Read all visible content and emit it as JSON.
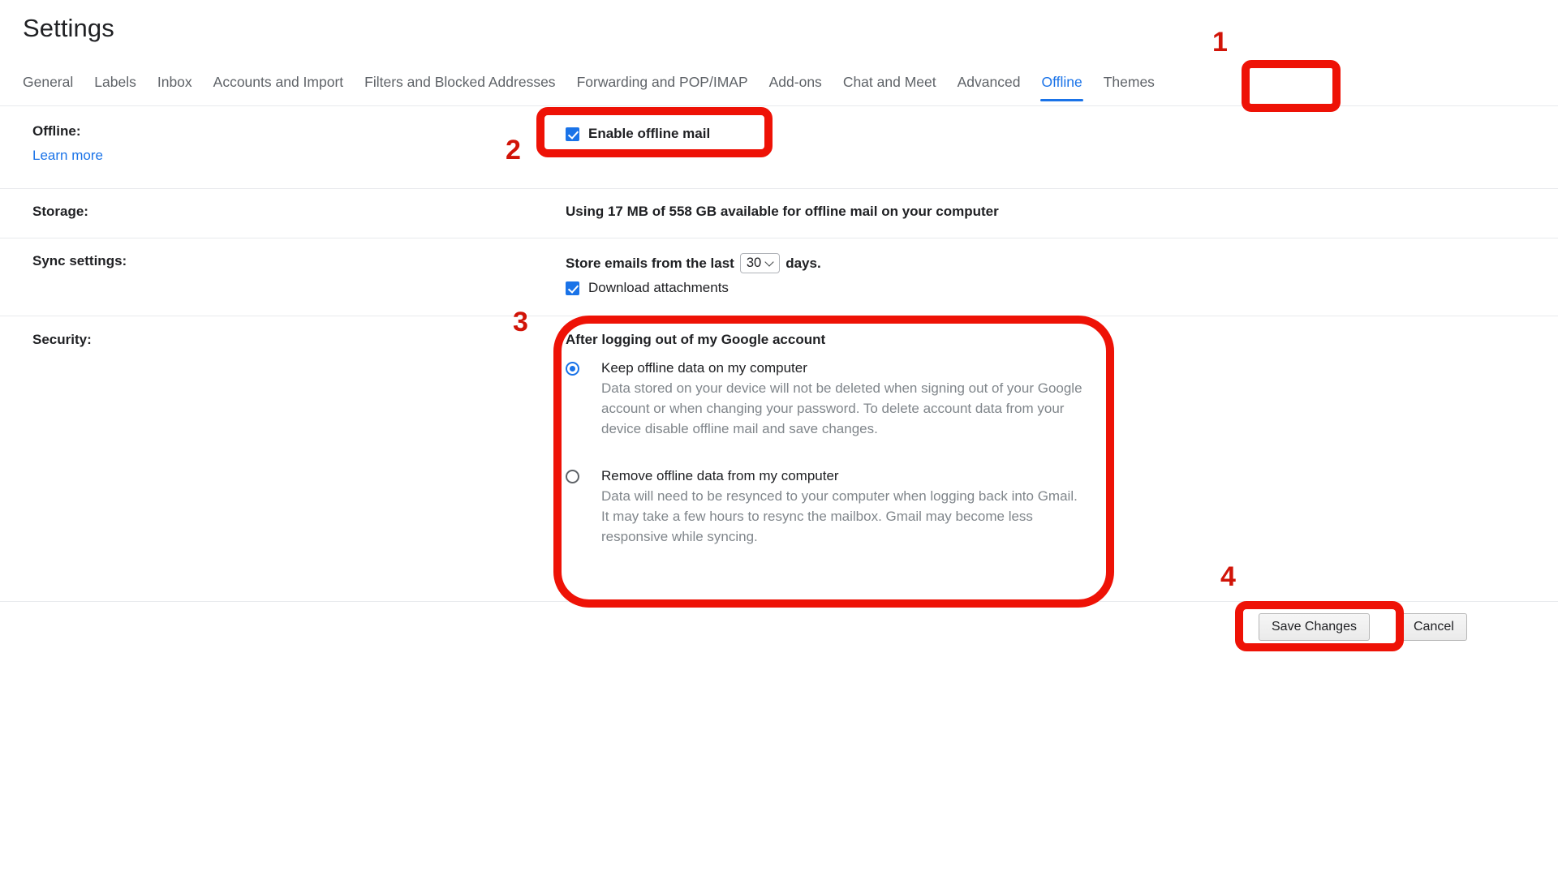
{
  "header": {
    "title": "Settings"
  },
  "tabs": [
    {
      "label": "General",
      "active": false
    },
    {
      "label": "Labels",
      "active": false
    },
    {
      "label": "Inbox",
      "active": false
    },
    {
      "label": "Accounts and Import",
      "active": false
    },
    {
      "label": "Filters and Blocked Addresses",
      "active": false
    },
    {
      "label": "Forwarding and POP/IMAP",
      "active": false
    },
    {
      "label": "Add-ons",
      "active": false
    },
    {
      "label": "Chat and Meet",
      "active": false
    },
    {
      "label": "Advanced",
      "active": false
    },
    {
      "label": "Offline",
      "active": true
    },
    {
      "label": "Themes",
      "active": false
    }
  ],
  "rows": {
    "offline": {
      "label": "Offline:",
      "learn_more": "Learn more",
      "enable_checkbox": {
        "label": "Enable offline mail",
        "checked": true
      }
    },
    "storage": {
      "label": "Storage:",
      "text": "Using 17 MB of 558 GB available for offline mail on your computer"
    },
    "sync": {
      "label": "Sync settings:",
      "prefix": "Store emails from the last",
      "days_value": "30",
      "suffix": "days.",
      "download_checkbox": {
        "label": "Download attachments",
        "checked": true
      }
    },
    "security": {
      "label": "Security:",
      "heading": "After logging out of my Google account",
      "options": [
        {
          "title": "Keep offline data on my computer",
          "description": "Data stored on your device will not be deleted when signing out of your Google account or when changing your password. To delete account data from your device disable offline mail and save changes.",
          "selected": true
        },
        {
          "title": "Remove offline data from my computer",
          "description": "Data will need to be resynced to your computer when logging back into Gmail. It may take a few hours to resync the mailbox. Gmail may become less responsive while syncing.",
          "selected": false
        }
      ]
    }
  },
  "buttons": {
    "save": "Save Changes",
    "cancel": "Cancel"
  },
  "annotations": [
    {
      "number": "1",
      "target": "offline-tab"
    },
    {
      "number": "2",
      "target": "enable-offline-mail-checkbox"
    },
    {
      "number": "3",
      "target": "security-options-group"
    },
    {
      "number": "4",
      "target": "save-changes-button"
    }
  ],
  "colors": {
    "accent_blue": "#1a73e8",
    "annotation_red": "#ee1206",
    "text_primary": "#202124",
    "text_secondary": "#5f6368",
    "text_muted": "#80868b",
    "divider": "#e8eaed"
  }
}
